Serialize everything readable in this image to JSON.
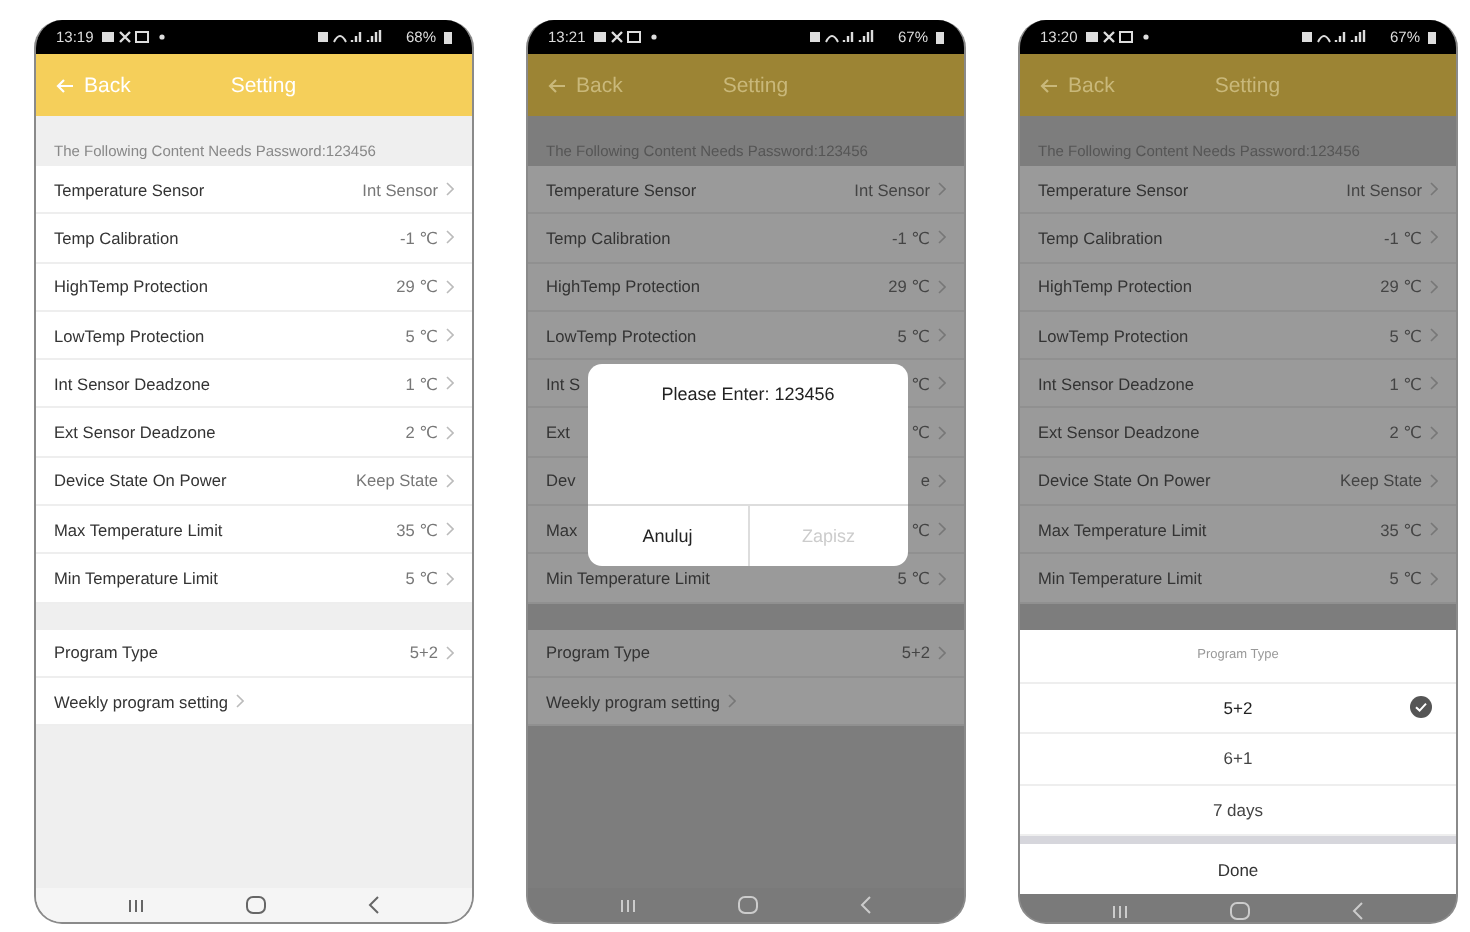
{
  "phones": [
    {
      "kind": "plain",
      "status_bar": {
        "time": "13:19",
        "battery": "68%"
      },
      "header": {
        "back": "Back",
        "title": "Setting"
      },
      "notice": "The Following Content Needs Password:123456",
      "settings": [
        {
          "label": "Temperature Sensor",
          "value": "Int Sensor"
        },
        {
          "label": "Temp Calibration",
          "value": "-1 ℃"
        },
        {
          "label": "HighTemp Protection",
          "value": "29 ℃"
        },
        {
          "label": "LowTemp Protection",
          "value": "5 ℃"
        },
        {
          "label": "Int Sensor Deadzone",
          "value": "1 ℃"
        },
        {
          "label": "Ext Sensor Deadzone",
          "value": "2 ℃"
        },
        {
          "label": "Device State On Power",
          "value": "Keep State"
        },
        {
          "label": "Max Temperature Limit",
          "value": "35 ℃"
        },
        {
          "label": "Min Temperature Limit",
          "value": "5 ℃"
        }
      ],
      "program_settings": [
        {
          "label": "Program Type",
          "value": "5+2"
        },
        {
          "label": "Weekly program setting"
        }
      ]
    },
    {
      "kind": "dialog",
      "status_bar": {
        "time": "13:21",
        "battery": "67%"
      },
      "header": {
        "back": "Back",
        "title": "Setting"
      },
      "notice": "The Following Content Needs Password:123456",
      "settings": [
        {
          "label": "Temperature Sensor",
          "value": "Int Sensor"
        },
        {
          "label": "Temp Calibration",
          "value": "-1 ℃"
        },
        {
          "label": "HighTemp Protection",
          "value": "29 ℃"
        },
        {
          "label": "LowTemp Protection",
          "value": "5 ℃"
        }
      ],
      "covered_settings": [
        {
          "label": "Int S",
          "value": "℃"
        },
        {
          "label": "Ext",
          "value": "℃"
        },
        {
          "label": "Dev",
          "value": "e"
        },
        {
          "label": "Max",
          "value": "℃"
        }
      ],
      "dialog": {
        "message": "Please Enter: 123456",
        "buttons": [
          {
            "label": "Anuluj",
            "disabled": false
          },
          {
            "label": "Zapisz",
            "disabled": true
          }
        ]
      },
      "settings_below": [
        {
          "label": "Min Temperature Limit",
          "value": "5 ℃"
        }
      ],
      "program_settings": [
        {
          "label": "Program Type",
          "value": "5+2"
        },
        {
          "label": "Weekly program setting"
        }
      ]
    },
    {
      "kind": "sheet",
      "status_bar": {
        "time": "13:20",
        "battery": "67%"
      },
      "header": {
        "back": "Back",
        "title": "Setting"
      },
      "notice": "The Following Content Needs Password:123456",
      "settings": [
        {
          "label": "Temperature Sensor",
          "value": "Int Sensor"
        },
        {
          "label": "Temp Calibration",
          "value": "-1 ℃"
        },
        {
          "label": "HighTemp Protection",
          "value": "29 ℃"
        },
        {
          "label": "LowTemp Protection",
          "value": "5 ℃"
        },
        {
          "label": "Int Sensor Deadzone",
          "value": "1 ℃"
        },
        {
          "label": "Ext Sensor Deadzone",
          "value": "2 ℃"
        },
        {
          "label": "Device State On Power",
          "value": "Keep State"
        },
        {
          "label": "Max Temperature Limit",
          "value": "35 ℃"
        },
        {
          "label": "Min Temperature Limit",
          "value": "5 ℃"
        }
      ],
      "sheet": {
        "title": "Program Type",
        "options": [
          {
            "label": "5+2",
            "selected": true
          },
          {
            "label": "6+1",
            "selected": false
          },
          {
            "label": "7 days",
            "selected": false
          }
        ],
        "done": "Done"
      }
    }
  ]
}
